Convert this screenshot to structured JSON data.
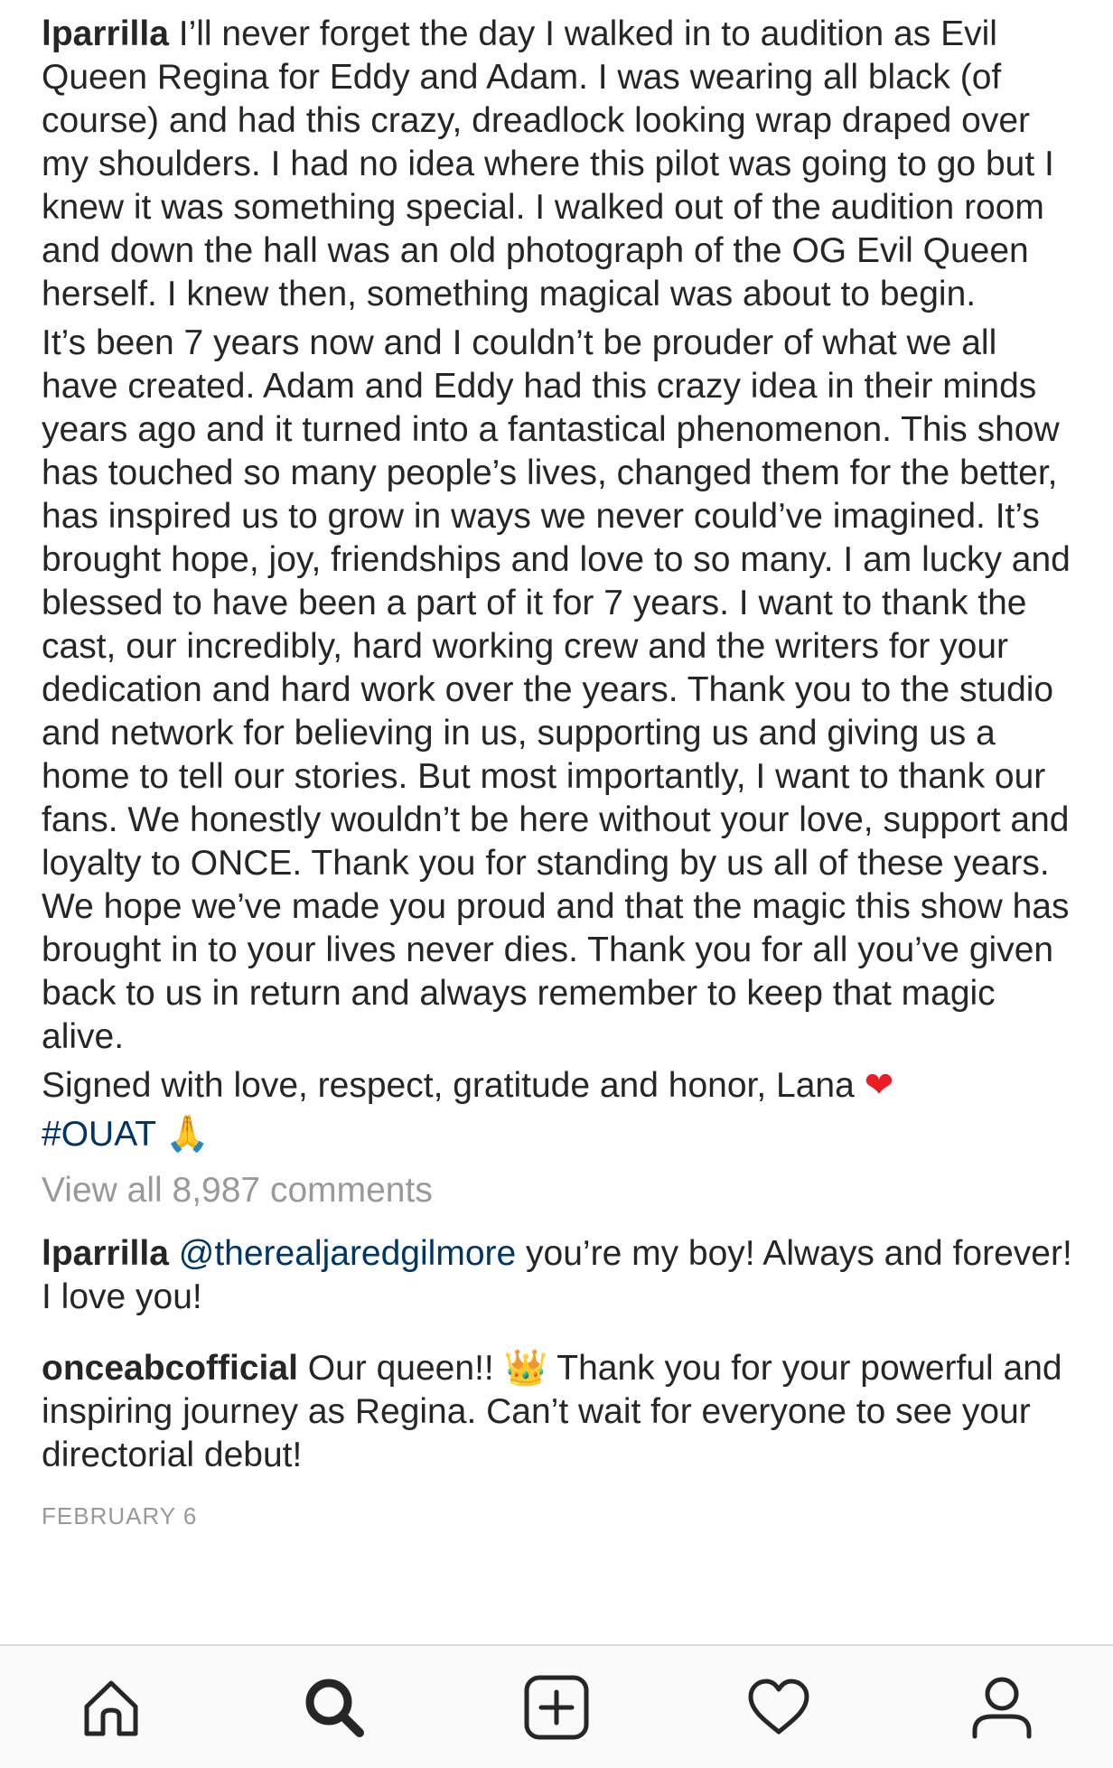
{
  "post": {
    "author": "lparrilla",
    "caption_p1": "I’ll never forget the day I walked in to audition as Evil Queen Regina for Eddy and Adam. I was wearing all black (of course) and had this crazy, dreadlock looking wrap draped over my shoulders. I had no idea where this pilot was going to go but I knew it was something special. I walked out of the audition room and down the hall was an old photograph of the OG Evil Queen herself. I knew then, something magical was about to begin.",
    "caption_p2": "It’s been 7 years now and I couldn’t be prouder of what we all have created. Adam and Eddy had this crazy idea in their minds years ago and it turned into a fantastical phenomenon. This show has touched so many people’s lives, changed them for the better, has inspired us to grow in ways we never could’ve imagined. It’s brought hope, joy, friendships and love to so many. I am lucky and blessed to have been a part of it for 7 years. I want to thank the cast, our incredibly, hard working crew and the writers for your dedication and hard work over the years. Thank you to the studio and network for believing in us, supporting us and giving us a home to tell our stories. But most importantly, I want to thank our fans. We honestly wouldn’t be here without your love, support and loyalty to ONCE. Thank you for standing by us all of these years. We hope we’ve made you proud and that the magic this show has brought in to your lives never dies. Thank you for all you’ve given back to us in return and always remember to keep that magic alive.",
    "signoff": "Signed with love, respect, gratitude and honor, Lana",
    "heart_emoji": "❤",
    "hashtag": "#OUAT",
    "pray_emoji": "🙏"
  },
  "view_all_comments": "View all 8,987 comments",
  "comments": [
    {
      "user": "lparrilla",
      "mention": "@therealjaredgilmore",
      "text": "you’re my boy! Always and forever! I love you!"
    },
    {
      "user": "onceabcofficial",
      "text_before": "Our queen!!",
      "emoji": "👑",
      "text_after": "Thank you for your powerful and inspiring journey as Regina. Can’t wait for everyone to see your directorial debut!"
    }
  ],
  "date": "FEBRUARY 6",
  "tabbar": {
    "icons": [
      "home-icon",
      "search-icon",
      "new-post-icon",
      "activity-heart-icon",
      "profile-icon"
    ]
  },
  "colors": {
    "text": "#262626",
    "link": "#003569",
    "muted": "#999999",
    "heart": "#ed1c24"
  }
}
